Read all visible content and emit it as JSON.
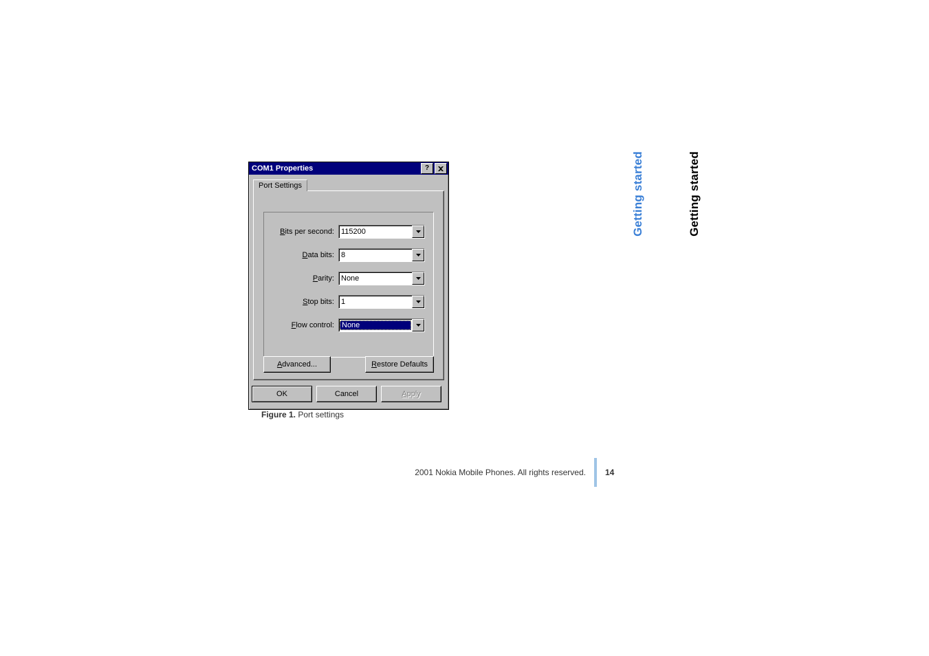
{
  "side": {
    "blue": "Getting started",
    "black": "Getting started"
  },
  "dialog": {
    "title": "COM1 Properties",
    "tab": "Port Settings",
    "fields": {
      "bits_per_second": {
        "label_pre": "B",
        "label_rest": "its per second:",
        "value": "115200"
      },
      "data_bits": {
        "label_pre": "D",
        "label_rest": "ata bits:",
        "value": "8"
      },
      "parity": {
        "label_pre": "P",
        "label_rest": "arity:",
        "value": "None"
      },
      "stop_bits": {
        "label_pre": "S",
        "label_rest": "top bits:",
        "value": "1"
      },
      "flow_control": {
        "label_pre": "F",
        "label_rest": "low control:",
        "value": "None"
      }
    },
    "buttons": {
      "advanced_pre": "A",
      "advanced_rest": "dvanced...",
      "restore_pre": "R",
      "restore_rest": "estore Defaults",
      "ok": "OK",
      "cancel": "Cancel",
      "apply_pre": "A",
      "apply_rest": "pply"
    }
  },
  "caption": {
    "label": "Figure 1.",
    "text": " Port settings"
  },
  "footer": {
    "copyright": "2001 Nokia Mobile Phones. All rights reserved.",
    "page": "14"
  }
}
